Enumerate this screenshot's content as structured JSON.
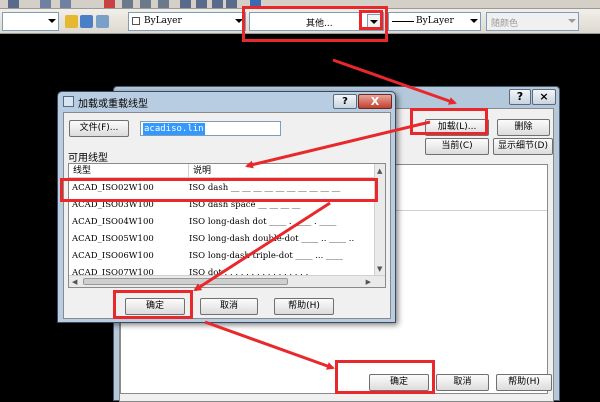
{
  "toolbar": {
    "bylayer_combo": "ByLayer",
    "linetype_combo": "其他...",
    "lineweight_combo": "ByLayer",
    "color_combo": "随颜色"
  },
  "big_dialog": {
    "help_label": "?",
    "close_label": "×",
    "load_button": "加载(L)...",
    "delete_button": "删除",
    "current_button": "当前(C)",
    "details_button": "显示细节(D)",
    "ok_button": "确定",
    "cancel_button": "取消",
    "help_button": "帮助(H)"
  },
  "small_dialog": {
    "title": "加载或重载线型",
    "help_label": "?",
    "close_label": "X",
    "file_button": "文件(F)...",
    "file_value": "acadiso.lin",
    "list_label": "可用线型",
    "col_linetype": "线型",
    "col_description": "说明",
    "rows": [
      {
        "name": "ACAD_ISO02W100",
        "desc": "ISO dash __ __ __ __ __ __ __ __ __ __"
      },
      {
        "name": "ACAD_ISO03W100",
        "desc": "ISO dash space __    __    __    __"
      },
      {
        "name": "ACAD_ISO04W100",
        "desc": "ISO long-dash dot ____ . ____ . ____"
      },
      {
        "name": "ACAD_ISO05W100",
        "desc": "ISO long-dash double-dot ____ .. ____ .."
      },
      {
        "name": "ACAD_ISO06W100",
        "desc": "ISO long-dash triple-dot ____ ... ____"
      },
      {
        "name": "ACAD_ISO07W100",
        "desc": "ISO dot . . . . . . . . . . . . . . . ."
      }
    ],
    "ok_button": "确定",
    "cancel_button": "取消",
    "help_button": "帮助(H)"
  },
  "colors": {
    "annotation_red": "#e8282b",
    "dialog_frame": "#b9cde2",
    "selection_blue": "#3399ff"
  }
}
